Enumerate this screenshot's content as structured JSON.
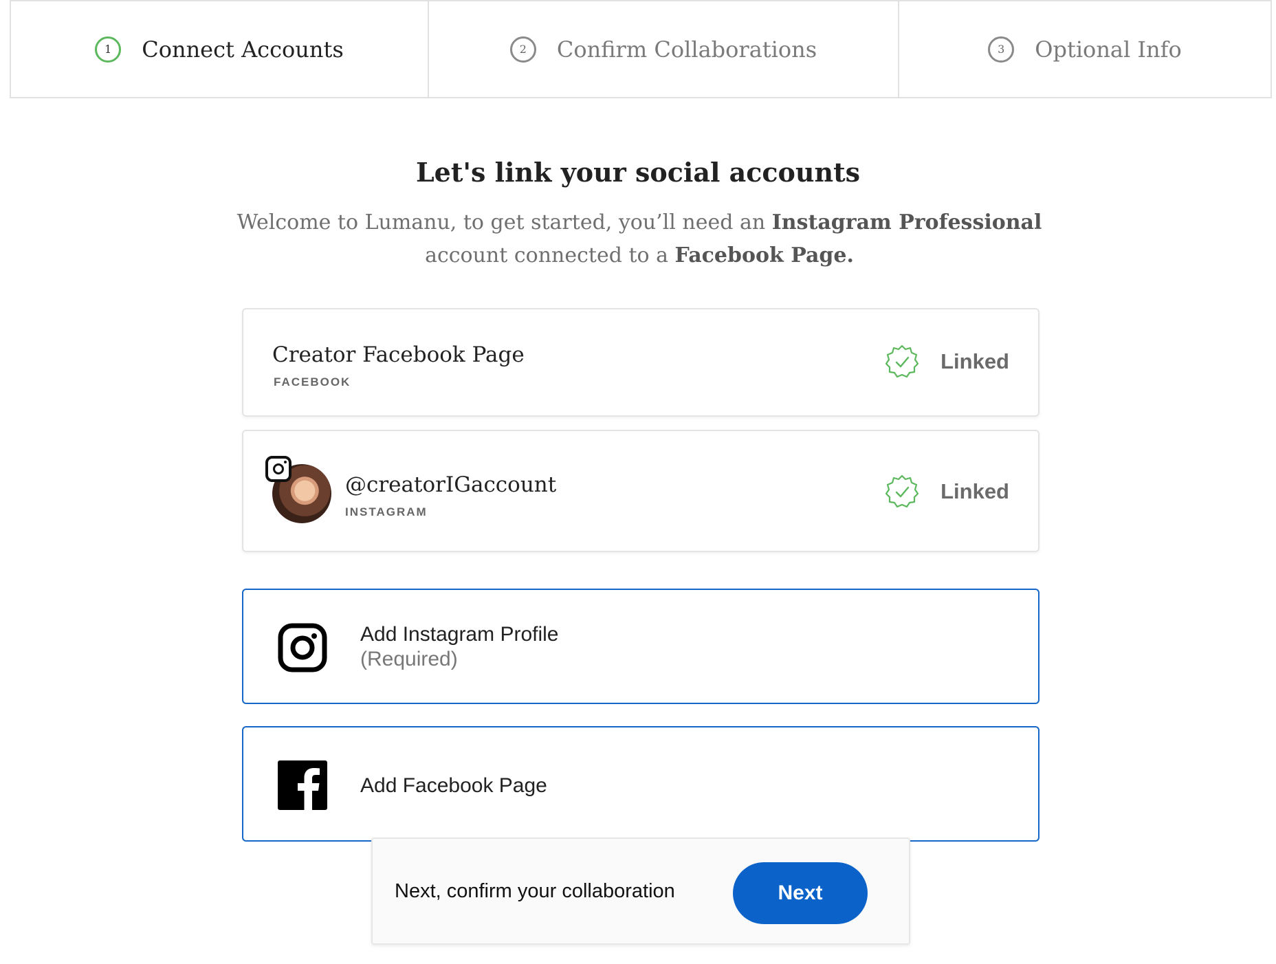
{
  "stepper": {
    "steps": [
      {
        "number": "1",
        "label": "Connect Accounts",
        "state": "active"
      },
      {
        "number": "2",
        "label": "Confirm Collaborations",
        "state": "pending"
      },
      {
        "number": "3",
        "label": "Optional Info",
        "state": "pending"
      }
    ]
  },
  "header": {
    "title": "Let's link your social accounts",
    "subtitle_part1": "Welcome to Lumanu, to get started, you’ll need an ",
    "subtitle_bold1": "Instagram Professional",
    "subtitle_part2": " account connected to a ",
    "subtitle_bold2": "Facebook Page."
  },
  "linked_accounts": [
    {
      "name": "Creator Facebook Page",
      "platform": "FACEBOOK",
      "status": "Linked",
      "status_icon": "check-badge-icon"
    },
    {
      "name": "@creatorIGaccount",
      "platform": "INSTAGRAM",
      "status": "Linked",
      "status_icon": "check-badge-icon"
    }
  ],
  "add_buttons": {
    "instagram": {
      "label": "Add Instagram Profile",
      "hint": "(Required)",
      "icon": "instagram-icon"
    },
    "facebook": {
      "label": "Add Facebook Page",
      "icon": "facebook-icon"
    }
  },
  "footer": {
    "text": "Next, confirm your collaboration",
    "next_label": "Next"
  },
  "colors": {
    "accent_blue": "#0b63c9",
    "border_blue": "#1667c7",
    "success_green": "#5cb85c"
  }
}
